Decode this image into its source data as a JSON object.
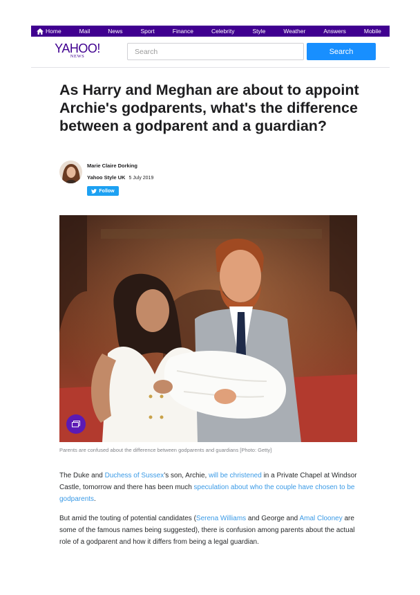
{
  "nav": {
    "items": [
      "Home",
      "Mail",
      "News",
      "Sport",
      "Finance",
      "Celebrity",
      "Style",
      "Weather",
      "Answers",
      "Mobile"
    ]
  },
  "header": {
    "logo_text": "YAHOO!",
    "logo_sub": "NEWS",
    "search_placeholder": "Search",
    "search_button": "Search"
  },
  "article": {
    "headline": "As Harry and Meghan are about to appoint Archie's godparents, what's the difference between a godparent and a guardian?",
    "author": "Marie Claire Dorking",
    "source": "Yahoo Style UK",
    "date": "5 July 2019",
    "follow_label": "Follow",
    "caption": "Parents are confused about the difference between godparents and guardians [Photo: Getty]",
    "p1": [
      "The Duke and ",
      "Duchess of Sussex",
      "’s son, Archie, ",
      "will be christened",
      " in a Private Chapel at Windsor Castle, tomorrow and there has been much ",
      "speculation about who the couple have chosen to be godparents",
      "."
    ],
    "p2": [
      "But amid the touting of potential candidates (",
      "Serena Williams",
      " and George and ",
      "Amal Clooney",
      " are some of the famous names being suggested), there is confusion among parents about the actual role of a godparent and how it differs from being a legal guardian."
    ]
  },
  "colors": {
    "nav_bg": "#400090",
    "brand": "#400090",
    "search_button": "#188fff",
    "link": "#3a9ae6",
    "twitter": "#1da1f2",
    "gallery_badge": "#5b1ab5"
  }
}
